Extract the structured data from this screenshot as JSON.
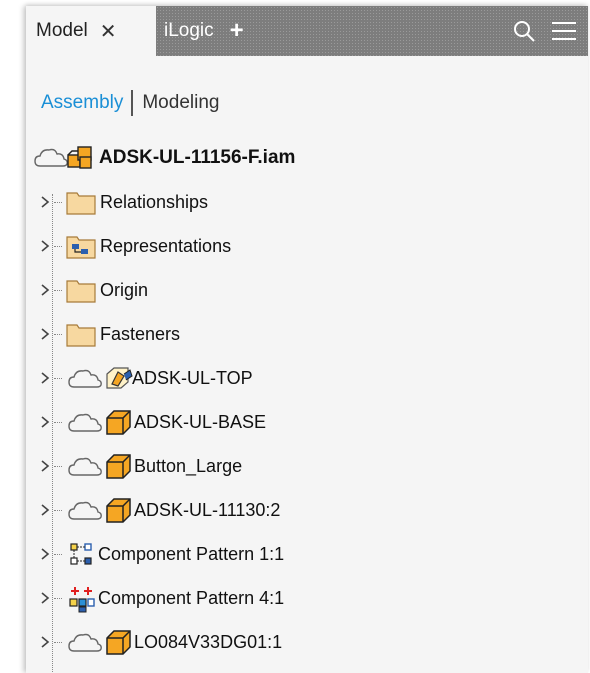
{
  "tabs": {
    "model_label": "Model",
    "ilogic_label": "iLogic"
  },
  "view_switch": {
    "assembly": "Assembly",
    "modeling": "Modeling"
  },
  "tree": {
    "root": {
      "label": "ADSK-UL-11156-F.iam",
      "icon": "assembly-icon"
    },
    "items": [
      {
        "label": "Relationships",
        "icon": "folder-icon"
      },
      {
        "label": "Representations",
        "icon": "representations-icon"
      },
      {
        "label": "Origin",
        "icon": "folder-icon"
      },
      {
        "label": "Fasteners",
        "icon": "folder-icon"
      },
      {
        "label": "ADSK-UL-TOP",
        "icon": "substitute-part-icon"
      },
      {
        "label": "ADSK-UL-BASE",
        "icon": "part-icon"
      },
      {
        "label": "Button_Large",
        "icon": "part-icon"
      },
      {
        "label": "ADSK-UL-11130:2",
        "icon": "part-icon"
      },
      {
        "label": "Component Pattern 1:1",
        "icon": "rect-pattern-icon"
      },
      {
        "label": "Component Pattern 4:1",
        "icon": "pattern-icon"
      },
      {
        "label": "LO084V33DG01:1",
        "icon": "part-icon"
      }
    ]
  },
  "colors": {
    "accent": "#1a8fd6",
    "part": "#f5a623",
    "folder": "#f7d8a0",
    "tab_inactive": "#7d7d7d"
  }
}
